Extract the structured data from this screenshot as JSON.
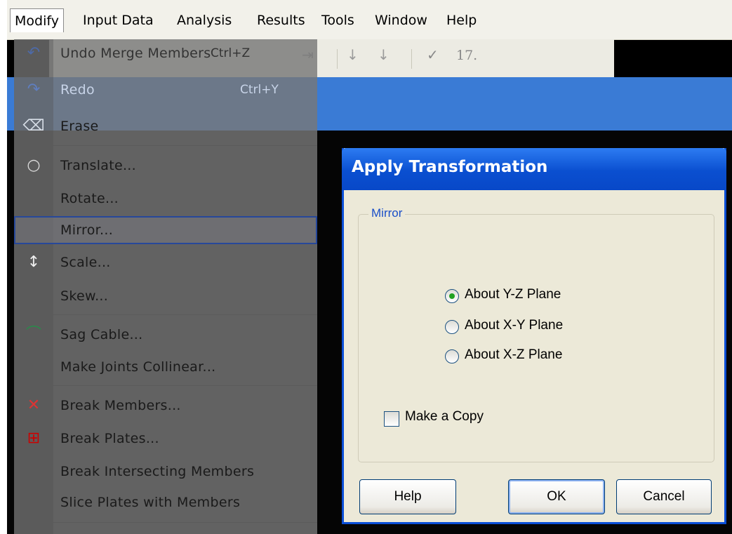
{
  "menubar": {
    "items": [
      "Modify",
      "Input Data",
      "Analysis",
      "Results",
      "Tools",
      "Window",
      "Help"
    ]
  },
  "toolbar": {
    "zoom_value": "17."
  },
  "modify_menu": {
    "items": [
      {
        "label": "Undo Merge Members",
        "shortcut": "Ctrl+Z",
        "icon": "undo-icon"
      },
      {
        "label": "Redo",
        "shortcut": "Ctrl+Y",
        "icon": "redo-icon"
      },
      {
        "label": "Erase",
        "icon": "eraser-icon"
      },
      {
        "label": "Translate...",
        "icon": "translate-icon"
      },
      {
        "label": "Rotate..."
      },
      {
        "label": "Mirror...",
        "selected": true
      },
      {
        "label": "Scale...",
        "icon": "scale-icon"
      },
      {
        "label": "Skew..."
      },
      {
        "label": "Sag Cable...",
        "icon": "sag-cable-icon"
      },
      {
        "label": "Make Joints Collinear..."
      },
      {
        "label": "Break Members...",
        "icon": "break-members-icon"
      },
      {
        "label": "Break Plates...",
        "icon": "break-plates-icon"
      },
      {
        "label": "Break Intersecting Members"
      },
      {
        "label": "Slice Plates with Members"
      }
    ]
  },
  "dialog": {
    "title": "Apply Transformation",
    "group_label": "Mirror",
    "options": [
      {
        "label": "About Y-Z Plane",
        "checked": true
      },
      {
        "label": "About X-Y Plane",
        "checked": false
      },
      {
        "label": "About X-Z Plane",
        "checked": false
      }
    ],
    "copy_label": "Make a Copy",
    "copy_checked": false,
    "buttons": {
      "help": "Help",
      "ok": "OK",
      "cancel": "Cancel"
    }
  },
  "colors": {
    "dialog_title_bar": "#0a4fd0",
    "selection_outline": "#27489a",
    "radio_dot": "#21a121"
  }
}
